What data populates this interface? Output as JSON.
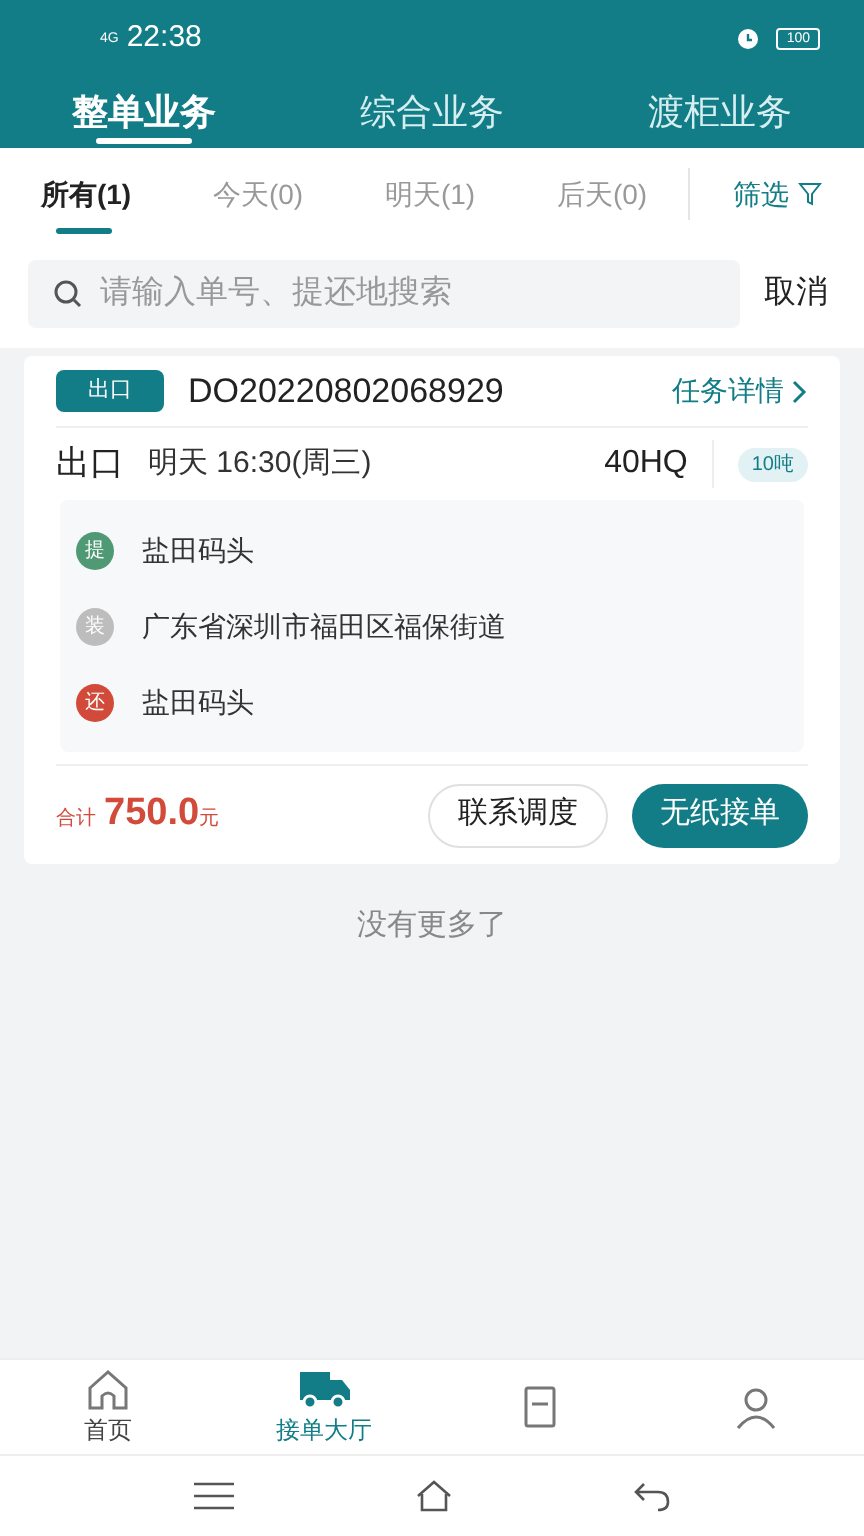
{
  "status_bar": {
    "network": "4G",
    "time": "22:38",
    "battery": "100"
  },
  "top_tabs": [
    {
      "label": "整单业务",
      "selected": true
    },
    {
      "label": "综合业务",
      "selected": false
    },
    {
      "label": "渡柜业务",
      "selected": false
    }
  ],
  "filter_tabs": [
    {
      "label": "所有(1)",
      "selected": true
    },
    {
      "label": "今天(0)",
      "selected": false
    },
    {
      "label": "明天(1)",
      "selected": false
    },
    {
      "label": "后天(0)",
      "selected": false
    }
  ],
  "filter_button": "筛选",
  "search": {
    "placeholder": "请输入单号、提还地搜索",
    "cancel": "取消"
  },
  "orders": [
    {
      "type_badge": "出口",
      "order_no": "DO20220802068929",
      "details_link": "任务详情",
      "direction": "出口",
      "time": "明天 16:30(周三)",
      "container": "40HQ",
      "weight": "10吨",
      "stops": [
        {
          "badge": "提",
          "color": "#4f9a74",
          "text": "盐田码头"
        },
        {
          "badge": "装",
          "color": "#bdbdbd",
          "text": "广东省深圳市福田区福保街道"
        },
        {
          "badge": "还",
          "color": "#d24a3a",
          "text": "盐田码头"
        }
      ],
      "total_label": "合计",
      "amount": "750.0",
      "unit": "元",
      "buttons": [
        {
          "label": "联系调度",
          "primary": false
        },
        {
          "label": "无纸接单",
          "primary": true
        }
      ]
    }
  ],
  "end_text": "没有更多了",
  "bottom_nav": [
    {
      "kind": "home",
      "label": "首页",
      "selected": false
    },
    {
      "kind": "truck",
      "label": "接单大厅",
      "selected": true
    },
    {
      "kind": "document",
      "selected": false
    },
    {
      "kind": "person",
      "selected": false
    }
  ]
}
